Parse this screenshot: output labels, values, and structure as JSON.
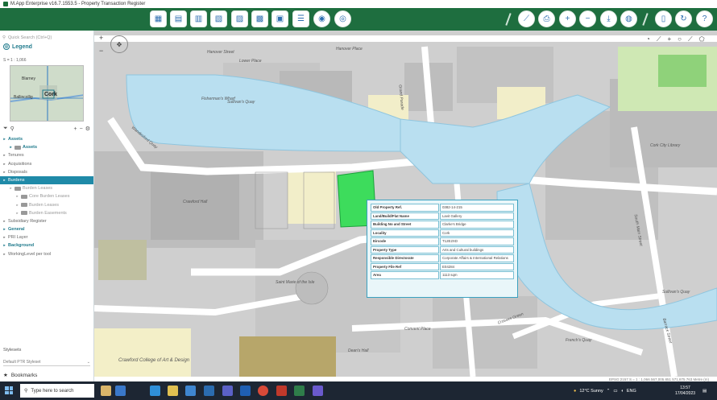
{
  "window": {
    "title": "M.App Enterprise v16.7.1553.5 - Property Transaction Register"
  },
  "left_panel": {
    "search_placeholder": "Quick Search (Ctrl+Q)",
    "legend_title": "Legend",
    "scale_text": "S = 1 : 1,066",
    "overview_labels": {
      "city": "Cork",
      "place1": "Blarney",
      "place2": "Ballincollig"
    },
    "tree": [
      {
        "label": "Assets",
        "kind": "hdr",
        "indent": 0
      },
      {
        "label": "Assets",
        "kind": "hdr",
        "indent": 1
      },
      {
        "label": "Tenures",
        "kind": "normal",
        "indent": 0
      },
      {
        "label": "Acquisitions",
        "kind": "normal",
        "indent": 0
      },
      {
        "label": "Disposals",
        "kind": "normal",
        "indent": 0
      },
      {
        "label": "Burdens",
        "kind": "selected",
        "indent": 0
      },
      {
        "label": "Burden Leases",
        "kind": "child",
        "indent": 1
      },
      {
        "label": "Core Burden Leases",
        "kind": "child",
        "indent": 2
      },
      {
        "label": "Burden Leases",
        "kind": "child",
        "indent": 2
      },
      {
        "label": "Burden Easements",
        "kind": "child",
        "indent": 2
      },
      {
        "label": "Subsidiary Register",
        "kind": "normal",
        "indent": 0
      },
      {
        "label": "General",
        "kind": "hdr",
        "indent": 0
      },
      {
        "label": "PRI Layer",
        "kind": "normal",
        "indent": 0
      },
      {
        "label": "Background",
        "kind": "hdr",
        "indent": 0
      },
      {
        "label": "WorkingLevel per tool",
        "kind": "normal",
        "indent": 0
      }
    ],
    "stylesets_label": "Stylesets",
    "styleset_value": "Default PTR Styleset",
    "bookmarks_label": "Bookmarks"
  },
  "map_labels": [
    "Hanover Street",
    "Hanover Street",
    "Hanover Place",
    "Lower Place",
    "Fisherman's Wharf",
    "Sullivan's Quay",
    "Crawford Hall",
    "Cork City Library",
    "Crawford College of Art & Design",
    "Dean's Hall",
    "Convent Place",
    "French's Quay",
    "Sullivan's Quay",
    "Barrack Street",
    "South Main Street",
    "Saint Marie of the Isle",
    "Wandesford Quay",
    "Mardyke Street",
    "Grand Parade",
    "Crosses Green",
    "Bishop Street"
  ],
  "popup": {
    "rows": [
      {
        "key": "Old Property Ref.",
        "value": "0382-14-215"
      },
      {
        "key": "Land/Build/Flat Name",
        "value": "Lavit Gallery"
      },
      {
        "key": "Building No and Street",
        "value": "Clarke's Bridge"
      },
      {
        "key": "Locality",
        "value": "Cork"
      },
      {
        "key": "Eircode",
        "value": "T12E2XD"
      },
      {
        "key": "Property Type",
        "value": "Arts and Cultural buildings"
      },
      {
        "key": "Responsible Directorate",
        "value": "Corporate Affairs & International Relations"
      },
      {
        "key": "Property File Ref",
        "value": "E04284"
      },
      {
        "key": "Area",
        "value": "1113 sqm"
      }
    ]
  },
  "status_bar": {
    "text": "EPSG:2157   S = 1 : 1,066   567,005.851 571,875.763   Metre (m)"
  },
  "taskbar": {
    "search_placeholder": "Type here to search",
    "weather": "12°C  Sunny",
    "language": "ENG",
    "time": "13:57",
    "date": "17/04/2023"
  },
  "colors": {
    "toolbar_green": "#1e6e3f",
    "water": "#b9dff0",
    "selected_parcel": "#3ddc5c",
    "accent_teal": "#1f8aa8"
  }
}
